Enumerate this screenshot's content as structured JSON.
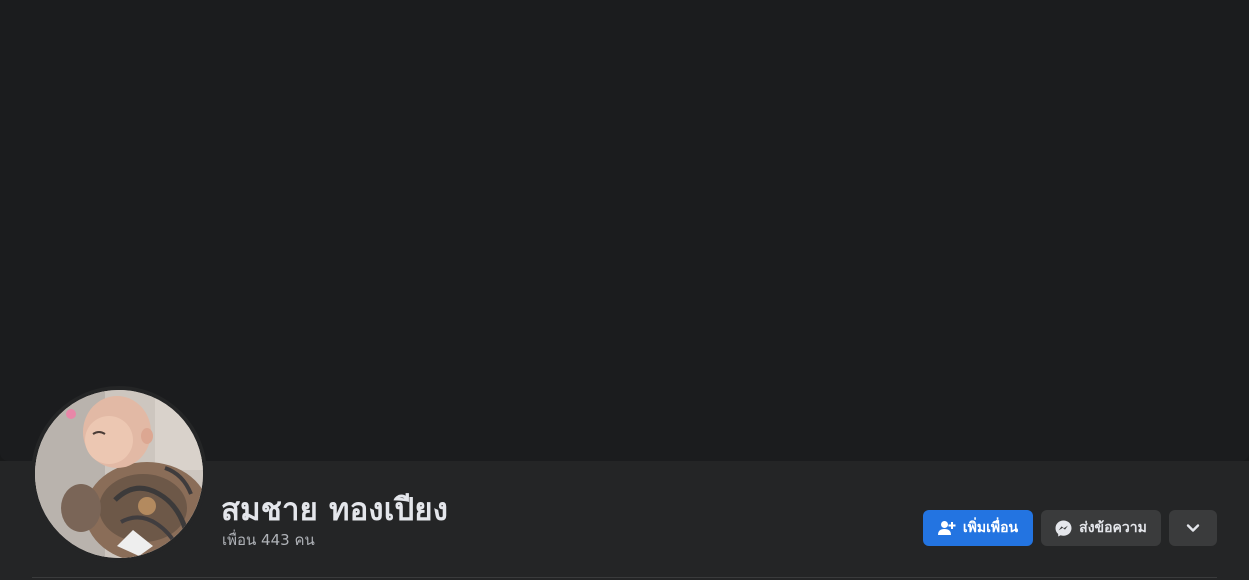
{
  "profile": {
    "name": "สมชาย ทองเปียง",
    "friends_text": "เพื่อน 443 คน"
  },
  "actions": {
    "add_friend_label": "เพิ่มเพื่อน",
    "message_label": "ส่งข้อความ"
  },
  "icons": {
    "add_friend": "person-plus-icon",
    "message": "messenger-icon",
    "more": "chevron-down-icon"
  },
  "colors": {
    "primary": "#2374e1",
    "secondary_button": "#3a3b3c",
    "header_background": "#242526",
    "cover_background": "#1b1c1e",
    "text_primary": "#e4e6eb",
    "text_secondary": "#b0b3b8"
  }
}
